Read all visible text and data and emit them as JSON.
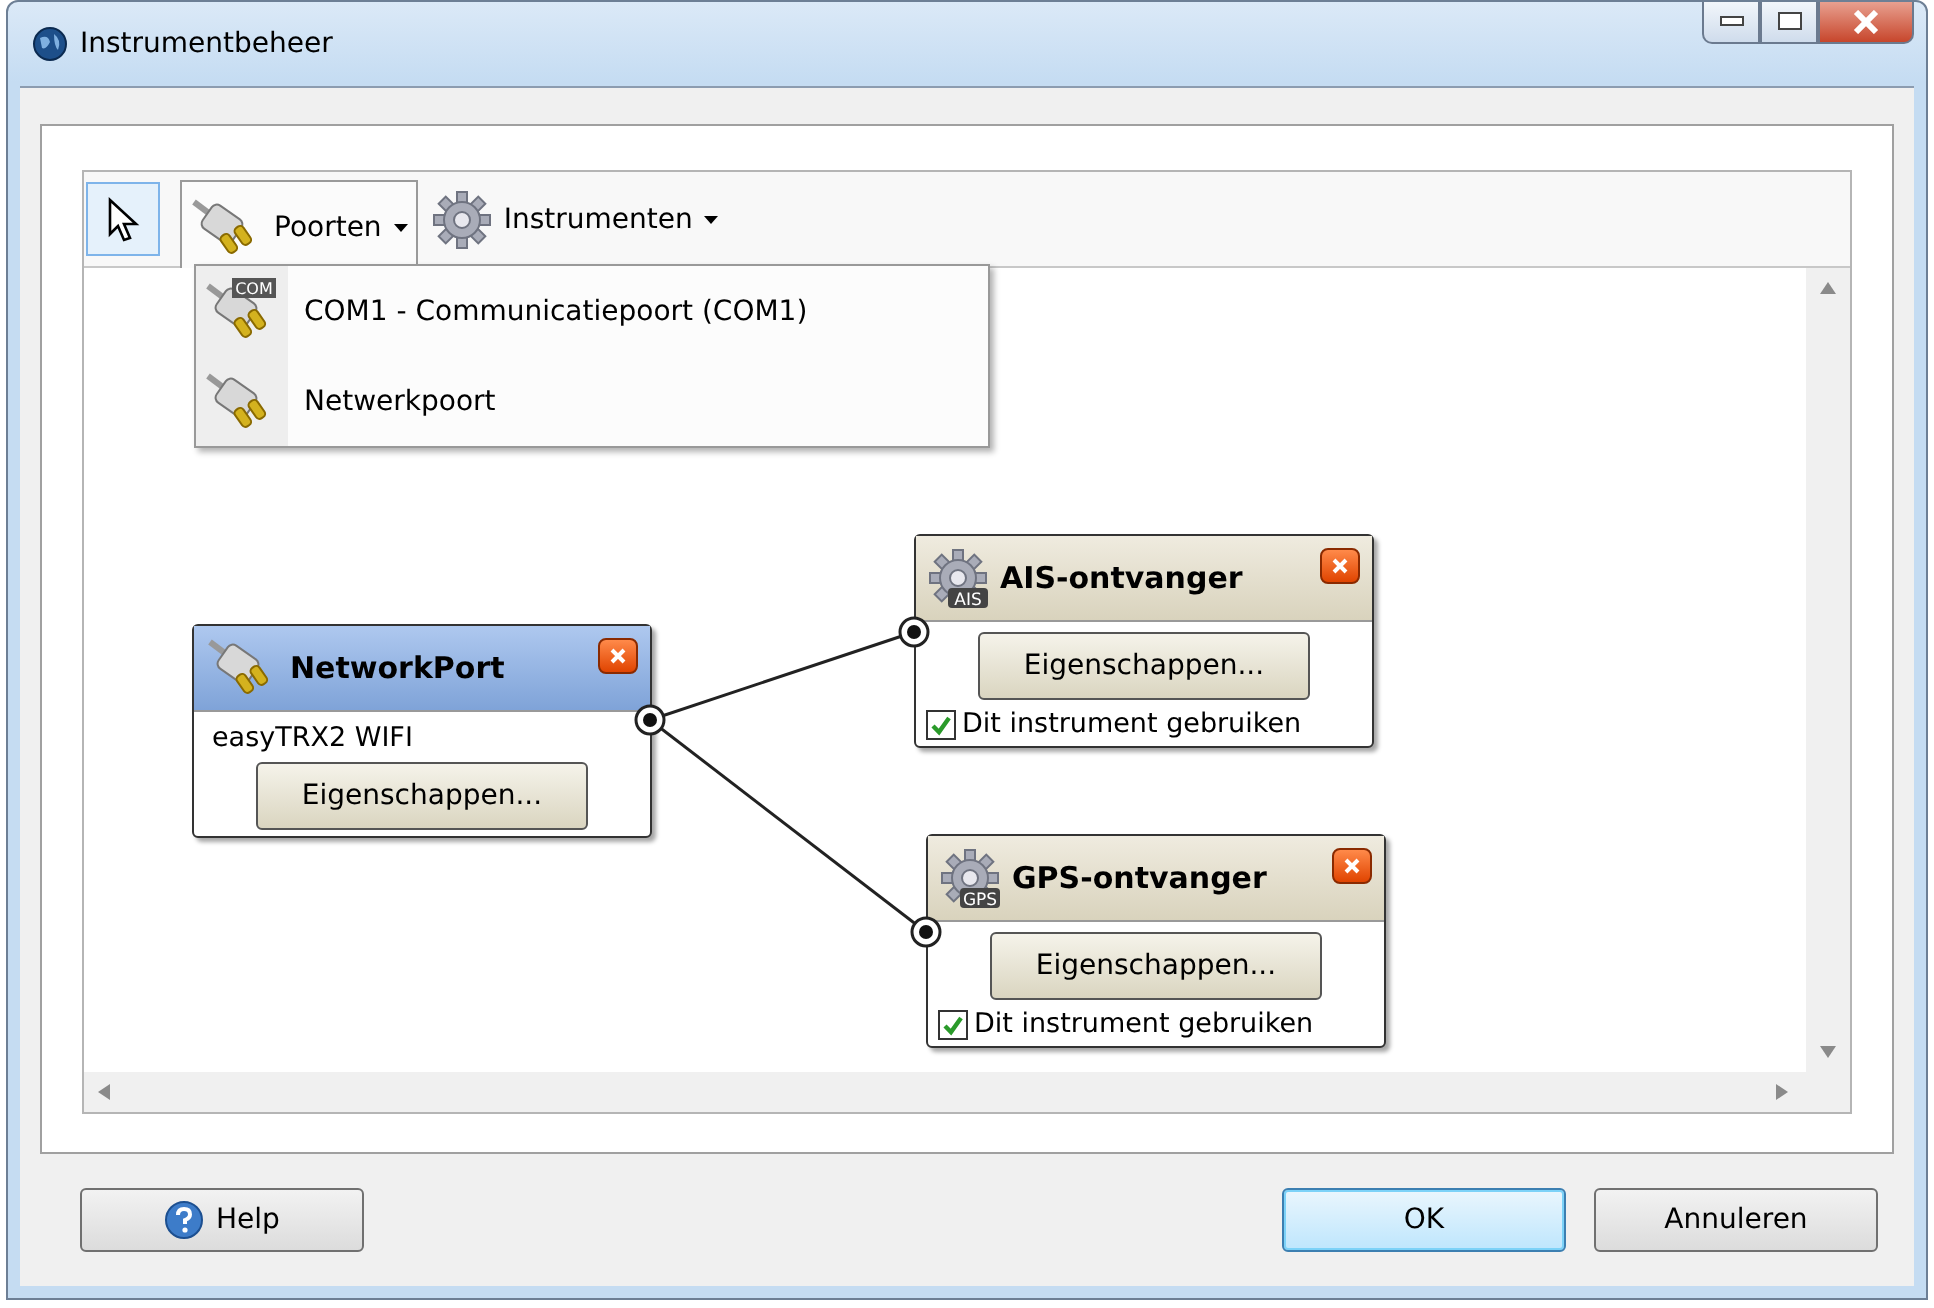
{
  "window": {
    "title": "Instrumentbeheer"
  },
  "toolbar": {
    "pointer_selected": true,
    "menus": [
      {
        "label": "Poorten",
        "open": true,
        "kind": "ports"
      },
      {
        "label": "Instrumenten",
        "open": false,
        "kind": "instruments"
      }
    ]
  },
  "dropdown": [
    {
      "label": "COM1 - Communicatiepoort (COM1)",
      "icon_badge": "COM"
    },
    {
      "label": "Netwerkpoort"
    }
  ],
  "nodes": [
    {
      "kind": "port",
      "title": "NetworkPort",
      "selected": true,
      "subtitle": "easyTRX2 WIFI",
      "button": "Eigenschappen..."
    },
    {
      "kind": "instrument",
      "title": "AIS-ontvanger",
      "selected": false,
      "badge": "AIS",
      "button": "Eigenschappen...",
      "checkbox": "Dit instrument gebruiken",
      "checked": true
    },
    {
      "kind": "instrument",
      "title": "GPS-ontvanger",
      "selected": false,
      "badge": "GPS",
      "button": "Eigenschappen...",
      "checkbox": "Dit instrument gebruiken",
      "checked": true
    }
  ],
  "buttons": [
    {
      "label": "Help",
      "kind": "help"
    },
    {
      "label": "OK",
      "kind": "default"
    },
    {
      "label": "Annuleren",
      "kind": "plain"
    }
  ]
}
